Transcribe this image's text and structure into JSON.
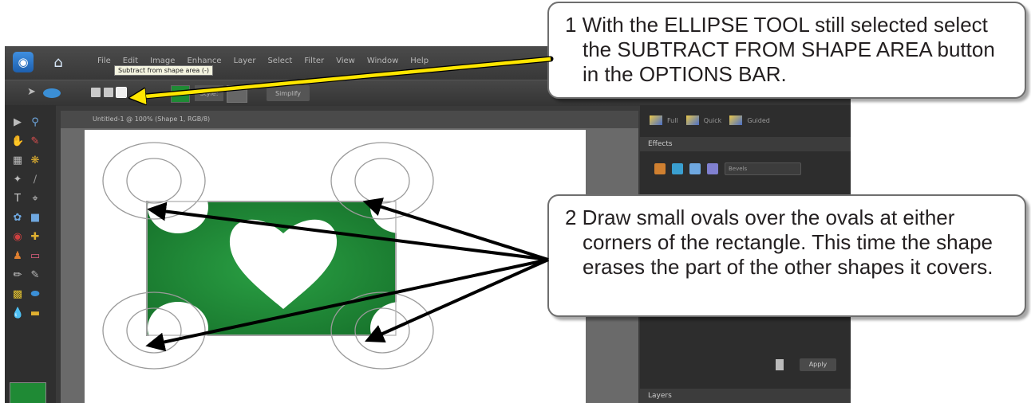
{
  "menu": {
    "items": [
      "File",
      "Edit",
      "Image",
      "Enhance",
      "Layer",
      "Select",
      "Filter",
      "View",
      "Window",
      "Help"
    ]
  },
  "options_bar": {
    "style_label": "Style:",
    "simplify_label": "Simplify",
    "tooltip": "Subtract from shape area (-)",
    "shape_color": "#1f8a35"
  },
  "document": {
    "tab_title": "Untitled-1 @ 100% (Shape 1, RGB/8)"
  },
  "right_panel": {
    "mode_tabs": [
      "Full",
      "Quick",
      "Guided"
    ],
    "effects_header": "Effects",
    "preset_label": "Bevels",
    "apply_label": "Apply",
    "layers_header": "Layers"
  },
  "callouts": {
    "step1": "1  With the ELLIPSE TOOL still selected select the SUBTRACT FROM SHAPE AREA button in the OPTIONS BAR.",
    "step2": "2  Draw small ovals over the ovals at either corners of the rectangle.  This time the shape erases the part of the other shapes it covers."
  },
  "colors": {
    "shape_green": "#1f8a35",
    "arrow_yellow": "#ffe600",
    "arrow_black": "#000000"
  }
}
